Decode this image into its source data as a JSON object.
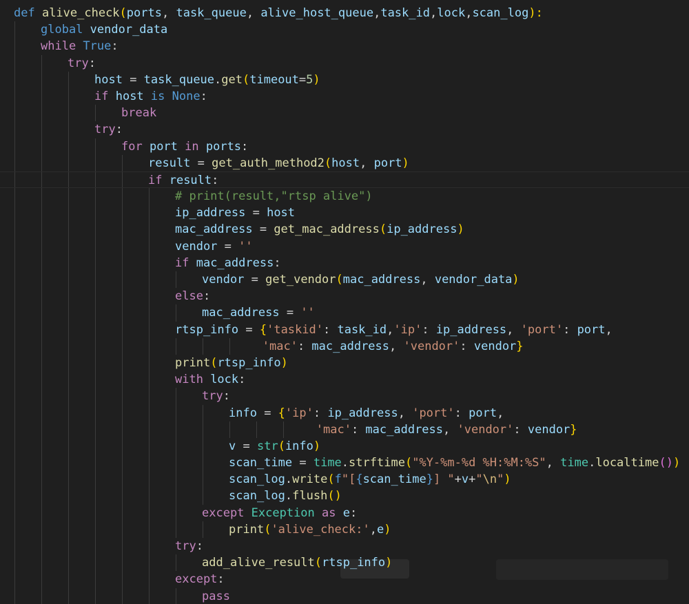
{
  "editor": {
    "language": "python",
    "theme": "dark",
    "background": "#1f1f1f",
    "colors": {
      "keyword": "#569cd6",
      "control": "#c586c0",
      "function": "#dcdcaa",
      "variable": "#9cdcfe",
      "string": "#ce9178",
      "number": "#b5cea8",
      "class": "#4ec9b0",
      "comment": "#6a9955",
      "bracket_1": "#ffd700",
      "bracket_2": "#da70d6",
      "bracket_3": "#179fff"
    },
    "lines": [
      {
        "indent": 0,
        "tokens": [
          [
            "def ",
            "kw"
          ],
          [
            "alive_check",
            "fn"
          ],
          [
            "(",
            "p1"
          ],
          [
            "ports",
            "var"
          ],
          [
            ", ",
            "txt"
          ],
          [
            "task_queue",
            "var"
          ],
          [
            ", ",
            "txt"
          ],
          [
            "alive_host_queue",
            "var"
          ],
          [
            ",",
            "txt"
          ],
          [
            "task_id",
            "var"
          ],
          [
            ",",
            "txt"
          ],
          [
            "lock",
            "var"
          ],
          [
            ",",
            "txt"
          ],
          [
            "scan_log",
            "var"
          ],
          [
            "):",
            "p1"
          ]
        ]
      },
      {
        "indent": 1,
        "tokens": [
          [
            "global ",
            "kw"
          ],
          [
            "vendor_data",
            "var"
          ]
        ]
      },
      {
        "indent": 1,
        "tokens": [
          [
            "while ",
            "ctrl"
          ],
          [
            "True",
            "kw"
          ],
          [
            ":",
            "txt"
          ]
        ]
      },
      {
        "indent": 2,
        "tokens": [
          [
            "try",
            "ctrl"
          ],
          [
            ":",
            "txt"
          ]
        ]
      },
      {
        "indent": 3,
        "tokens": [
          [
            "host",
            "var"
          ],
          [
            " = ",
            "txt"
          ],
          [
            "task_queue",
            "var"
          ],
          [
            ".",
            "txt"
          ],
          [
            "get",
            "fn"
          ],
          [
            "(",
            "p1"
          ],
          [
            "timeout",
            "var"
          ],
          [
            "=",
            "txt"
          ],
          [
            "5",
            "num"
          ],
          [
            ")",
            "p1"
          ]
        ]
      },
      {
        "indent": 3,
        "tokens": [
          [
            "if ",
            "ctrl"
          ],
          [
            "host",
            "var"
          ],
          [
            " is ",
            "kw"
          ],
          [
            "None",
            "kw"
          ],
          [
            ":",
            "txt"
          ]
        ]
      },
      {
        "indent": 4,
        "tokens": [
          [
            "break",
            "ctrl"
          ]
        ]
      },
      {
        "indent": 3,
        "tokens": [
          [
            "try",
            "ctrl"
          ],
          [
            ":",
            "txt"
          ]
        ]
      },
      {
        "indent": 4,
        "tokens": [
          [
            "for ",
            "ctrl"
          ],
          [
            "port",
            "var"
          ],
          [
            " in ",
            "ctrl"
          ],
          [
            "ports",
            "var"
          ],
          [
            ":",
            "txt"
          ]
        ]
      },
      {
        "indent": 5,
        "tokens": [
          [
            "result",
            "var"
          ],
          [
            " = ",
            "txt"
          ],
          [
            "get_auth_method2",
            "fn"
          ],
          [
            "(",
            "p1"
          ],
          [
            "host",
            "var"
          ],
          [
            ", ",
            "txt"
          ],
          [
            "port",
            "var"
          ],
          [
            ")",
            "p1"
          ]
        ]
      },
      {
        "indent": 5,
        "current": true,
        "tokens": [
          [
            "if ",
            "ctrl"
          ],
          [
            "result",
            "var"
          ],
          [
            ":",
            "txt"
          ]
        ]
      },
      {
        "indent": 6,
        "tokens": [
          [
            "# print(result,\"rtsp alive\")",
            "cmt"
          ]
        ]
      },
      {
        "indent": 6,
        "tokens": [
          [
            "ip_address",
            "var"
          ],
          [
            " = ",
            "txt"
          ],
          [
            "host",
            "var"
          ]
        ]
      },
      {
        "indent": 6,
        "tokens": [
          [
            "mac_address",
            "var"
          ],
          [
            " = ",
            "txt"
          ],
          [
            "get_mac_address",
            "fn"
          ],
          [
            "(",
            "p1"
          ],
          [
            "ip_address",
            "var"
          ],
          [
            ")",
            "p1"
          ]
        ]
      },
      {
        "indent": 6,
        "tokens": [
          [
            "vendor",
            "var"
          ],
          [
            " = ",
            "txt"
          ],
          [
            "''",
            "str"
          ]
        ]
      },
      {
        "indent": 6,
        "tokens": [
          [
            "if ",
            "ctrl"
          ],
          [
            "mac_address",
            "var"
          ],
          [
            ":",
            "txt"
          ]
        ]
      },
      {
        "indent": 7,
        "tokens": [
          [
            "vendor",
            "var"
          ],
          [
            " = ",
            "txt"
          ],
          [
            "get_vendor",
            "fn"
          ],
          [
            "(",
            "p1"
          ],
          [
            "mac_address",
            "var"
          ],
          [
            ", ",
            "txt"
          ],
          [
            "vendor_data",
            "var"
          ],
          [
            ")",
            "p1"
          ]
        ]
      },
      {
        "indent": 6,
        "tokens": [
          [
            "else",
            "ctrl"
          ],
          [
            ":",
            "txt"
          ]
        ]
      },
      {
        "indent": 7,
        "tokens": [
          [
            "mac_address",
            "var"
          ],
          [
            " = ",
            "txt"
          ],
          [
            "''",
            "str"
          ]
        ]
      },
      {
        "indent": 6,
        "tokens": [
          [
            "rtsp_info",
            "var"
          ],
          [
            " = ",
            "txt"
          ],
          [
            "{",
            "p1"
          ],
          [
            "'taskid'",
            "str"
          ],
          [
            ": ",
            "txt"
          ],
          [
            "task_id",
            "var"
          ],
          [
            ",",
            "txt"
          ],
          [
            "'ip'",
            "str"
          ],
          [
            ": ",
            "txt"
          ],
          [
            "ip_address",
            "var"
          ],
          [
            ", ",
            "txt"
          ],
          [
            "'port'",
            "str"
          ],
          [
            ": ",
            "txt"
          ],
          [
            "port",
            "var"
          ],
          [
            ",",
            "txt"
          ]
        ]
      },
      {
        "indent": 6,
        "continuation": 13,
        "tokens": [
          [
            "'mac'",
            "str"
          ],
          [
            ": ",
            "txt"
          ],
          [
            "mac_address",
            "var"
          ],
          [
            ", ",
            "txt"
          ],
          [
            "'vendor'",
            "str"
          ],
          [
            ": ",
            "txt"
          ],
          [
            "vendor",
            "var"
          ],
          [
            "}",
            "p1"
          ]
        ]
      },
      {
        "indent": 6,
        "tokens": [
          [
            "print",
            "fn"
          ],
          [
            "(",
            "p1"
          ],
          [
            "rtsp_info",
            "var"
          ],
          [
            ")",
            "p1"
          ]
        ]
      },
      {
        "indent": 6,
        "tokens": [
          [
            "with ",
            "ctrl"
          ],
          [
            "lock",
            "var"
          ],
          [
            ":",
            "txt"
          ]
        ]
      },
      {
        "indent": 7,
        "tokens": [
          [
            "try",
            "ctrl"
          ],
          [
            ":",
            "txt"
          ]
        ]
      },
      {
        "indent": 8,
        "tokens": [
          [
            "info",
            "var"
          ],
          [
            " = ",
            "txt"
          ],
          [
            "{",
            "p1"
          ],
          [
            "'ip'",
            "str"
          ],
          [
            ": ",
            "txt"
          ],
          [
            "ip_address",
            "var"
          ],
          [
            ", ",
            "txt"
          ],
          [
            "'port'",
            "str"
          ],
          [
            ": ",
            "txt"
          ],
          [
            "port",
            "var"
          ],
          [
            ",",
            "txt"
          ]
        ]
      },
      {
        "indent": 8,
        "continuation": 13,
        "tokens": [
          [
            "'mac'",
            "str"
          ],
          [
            ": ",
            "txt"
          ],
          [
            "mac_address",
            "var"
          ],
          [
            ", ",
            "txt"
          ],
          [
            "'vendor'",
            "str"
          ],
          [
            ": ",
            "txt"
          ],
          [
            "vendor",
            "var"
          ],
          [
            "}",
            "p1"
          ]
        ]
      },
      {
        "indent": 8,
        "tokens": [
          [
            "v",
            "var"
          ],
          [
            " = ",
            "txt"
          ],
          [
            "str",
            "cls"
          ],
          [
            "(",
            "p1"
          ],
          [
            "info",
            "var"
          ],
          [
            ")",
            "p1"
          ]
        ]
      },
      {
        "indent": 8,
        "tokens": [
          [
            "scan_time",
            "var"
          ],
          [
            " = ",
            "txt"
          ],
          [
            "time",
            "cls"
          ],
          [
            ".",
            "txt"
          ],
          [
            "strftime",
            "fn"
          ],
          [
            "(",
            "p1"
          ],
          [
            "\"%Y-%m-%d %H:%M:%S\"",
            "str"
          ],
          [
            ", ",
            "txt"
          ],
          [
            "time",
            "cls"
          ],
          [
            ".",
            "txt"
          ],
          [
            "localtime",
            "fn"
          ],
          [
            "(",
            "p2"
          ],
          [
            ")",
            "p2"
          ],
          [
            ")",
            "p1"
          ]
        ]
      },
      {
        "indent": 8,
        "tokens": [
          [
            "scan_log",
            "var"
          ],
          [
            ".",
            "txt"
          ],
          [
            "write",
            "fn"
          ],
          [
            "(",
            "p1"
          ],
          [
            "f",
            "kw"
          ],
          [
            "\"[",
            "str"
          ],
          [
            "{",
            "kw"
          ],
          [
            "scan_time",
            "var"
          ],
          [
            "}",
            "kw"
          ],
          [
            "] \"",
            "str"
          ],
          [
            "+",
            "txt"
          ],
          [
            "v",
            "var"
          ],
          [
            "+",
            "txt"
          ],
          [
            "\"",
            "str"
          ],
          [
            "\\n",
            "esc"
          ],
          [
            "\"",
            "str"
          ],
          [
            ")",
            "p1"
          ]
        ]
      },
      {
        "indent": 8,
        "tokens": [
          [
            "scan_log",
            "var"
          ],
          [
            ".",
            "txt"
          ],
          [
            "flush",
            "fn"
          ],
          [
            "(",
            "p1"
          ],
          [
            ")",
            "p1"
          ]
        ]
      },
      {
        "indent": 7,
        "tokens": [
          [
            "except ",
            "ctrl"
          ],
          [
            "Exception",
            "cls"
          ],
          [
            " as ",
            "ctrl"
          ],
          [
            "e",
            "var"
          ],
          [
            ":",
            "txt"
          ]
        ]
      },
      {
        "indent": 8,
        "tokens": [
          [
            "print",
            "fn"
          ],
          [
            "(",
            "p1"
          ],
          [
            "'alive_check:'",
            "str"
          ],
          [
            ",",
            "txt"
          ],
          [
            "e",
            "var"
          ],
          [
            ")",
            "p1"
          ]
        ]
      },
      {
        "indent": 6,
        "tokens": [
          [
            "try",
            "ctrl"
          ],
          [
            ":",
            "txt"
          ]
        ]
      },
      {
        "indent": 7,
        "tokens": [
          [
            "add_alive_result",
            "fn"
          ],
          [
            "(",
            "p1"
          ],
          [
            "rtsp_info",
            "var"
          ],
          [
            ")",
            "p1"
          ]
        ]
      },
      {
        "indent": 6,
        "tokens": [
          [
            "except",
            "ctrl"
          ],
          [
            ":",
            "txt"
          ]
        ]
      },
      {
        "indent": 7,
        "tokens": [
          [
            "pass",
            "ctrl"
          ]
        ]
      }
    ]
  }
}
